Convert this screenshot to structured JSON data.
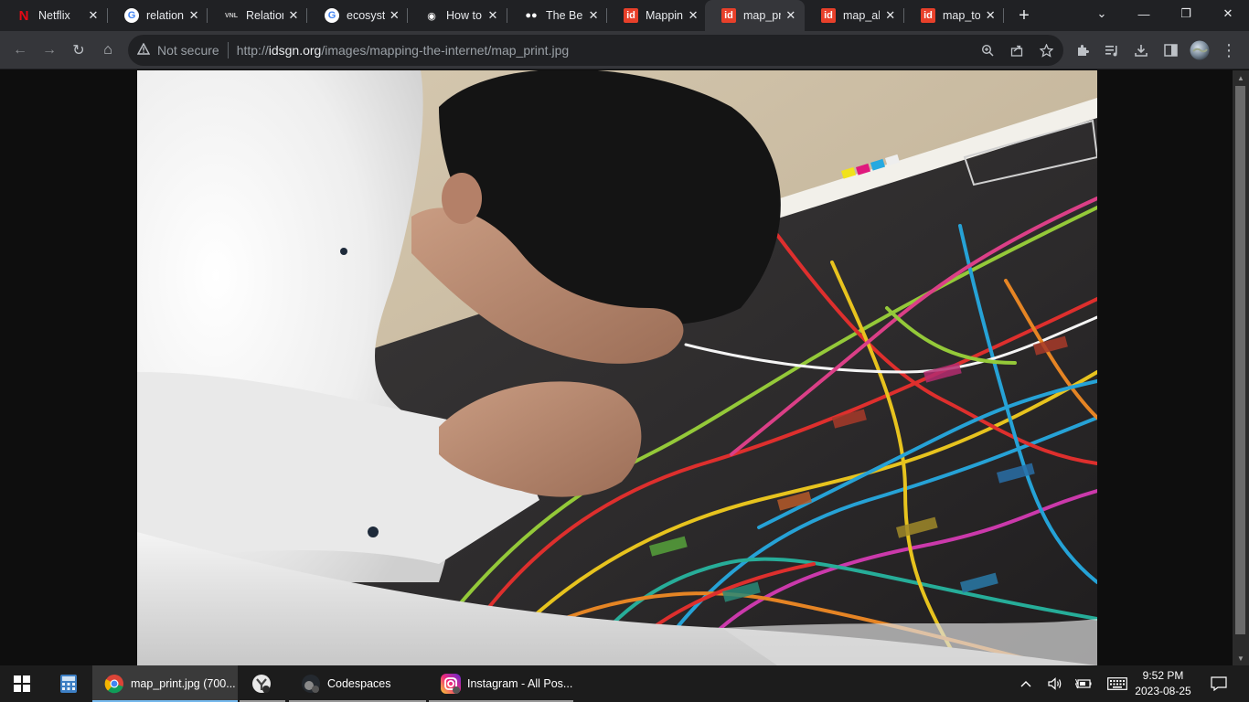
{
  "tabs": [
    {
      "title": "Netflix",
      "fav_text": "N",
      "fav_color": "#e50914",
      "fav_bg": "transparent"
    },
    {
      "title": "relations",
      "fav_text": "G",
      "fav_color": "#4285f4",
      "fav_bg": "#ffffff"
    },
    {
      "title": "Relation",
      "fav_text": "VNL",
      "fav_color": "#cccccc",
      "fav_bg": "transparent"
    },
    {
      "title": "ecosyste",
      "fav_text": "G",
      "fav_color": "#4285f4",
      "fav_bg": "#ffffff"
    },
    {
      "title": "How to",
      "fav_text": "◉",
      "fav_color": "#ffffff",
      "fav_bg": "transparent"
    },
    {
      "title": "The Ben",
      "fav_text": "●●",
      "fav_color": "#ffffff",
      "fav_bg": "transparent"
    },
    {
      "title": "Mapping",
      "fav_text": "id",
      "fav_color": "#ffffff",
      "fav_bg": "#e8402a"
    },
    {
      "title": "map_pri",
      "fav_text": "id",
      "fav_color": "#ffffff",
      "fav_bg": "#e8402a"
    },
    {
      "title": "map_all",
      "fav_text": "id",
      "fav_color": "#ffffff",
      "fav_bg": "#e8402a"
    },
    {
      "title": "map_top",
      "fav_text": "id",
      "fav_color": "#ffffff",
      "fav_bg": "#e8402a"
    }
  ],
  "active_tab": 7,
  "new_tab_label": "+",
  "window_controls": {
    "dropdown": "⌄",
    "minimize": "—",
    "restore": "❐",
    "close": "✕"
  },
  "toolbar": {
    "back": "←",
    "forward": "→",
    "reload": "↻",
    "home": "⌂"
  },
  "omnibox": {
    "security_label": "Not secure",
    "url_prefix": "http://",
    "url_host": "idsgn.org",
    "url_path": "/images/mapping-the-internet/map_print.jpg"
  },
  "taskbar": {
    "items": [
      {
        "label": "map_print.jpg (700...",
        "icon": "chrome-icon"
      },
      {
        "label": "",
        "icon": "app-icon"
      },
      {
        "label": "Codespaces",
        "icon": "codespaces-icon"
      },
      {
        "label": "Instagram - All Pos...",
        "icon": "instagram-icon"
      }
    ],
    "time": "9:52 PM",
    "date": "2023-08-25"
  }
}
